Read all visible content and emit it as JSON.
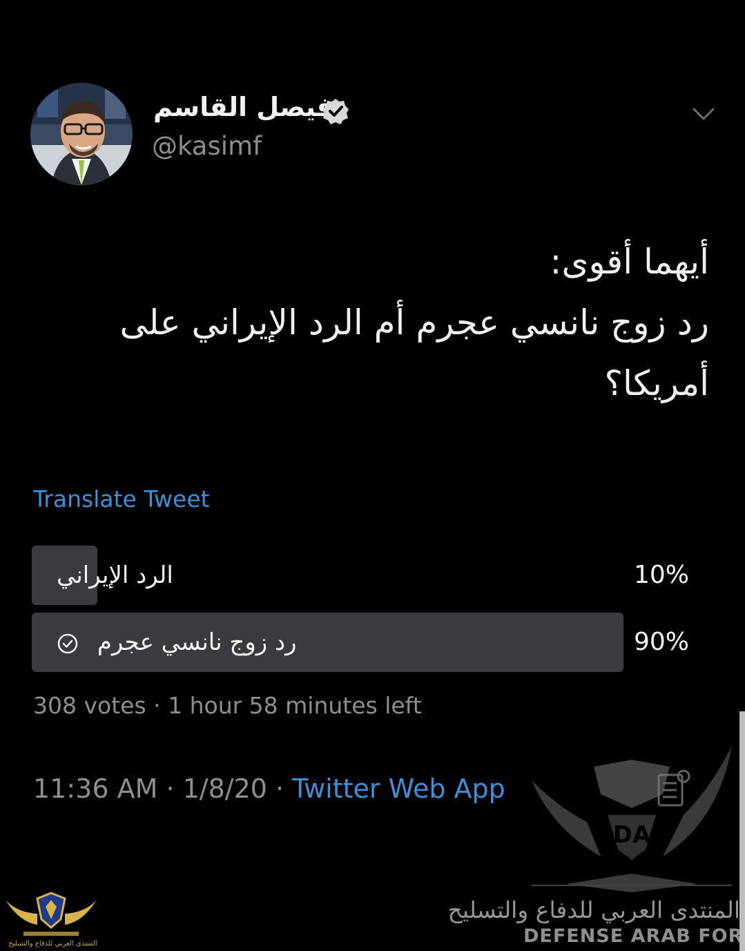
{
  "tweet": {
    "display_name": "فيصل القاسم",
    "handle": "@kasimf",
    "text_lines": [
      "أيهما أقوى:",
      "رد زوج نانسي عجرم أم الرد الإيراني على",
      "أمريكا؟"
    ],
    "translate_label": "Translate Tweet",
    "timestamp": "11:36 AM · 1/8/20 · ",
    "source": "Twitter Web App"
  },
  "poll": {
    "options": [
      {
        "label": "الرد الإيراني",
        "percent_text": "10%",
        "percent": 10,
        "selected": false
      },
      {
        "label": "رد زوج نانسي عجرم",
        "percent_text": "90%",
        "percent": 90,
        "selected": true
      }
    ],
    "meta": "308 votes · 1 hour 58 minutes left"
  },
  "watermark": {
    "arabic": "المنتدى العربي للدفاع والتسليح",
    "english": "DEFENSE ARAB FORUM",
    "corner_arabic": "المنتدى العربي للدفاع والتسليح"
  },
  "icons": {
    "verified": "verified-badge-icon",
    "chevron": "chevron-down-icon",
    "check": "check-circle-icon",
    "share": "share-icon"
  },
  "colors": {
    "background": "#000000",
    "link": "#3f8fd6",
    "muted": "#8b8f94",
    "poll_fill": "#3a3b3f"
  }
}
